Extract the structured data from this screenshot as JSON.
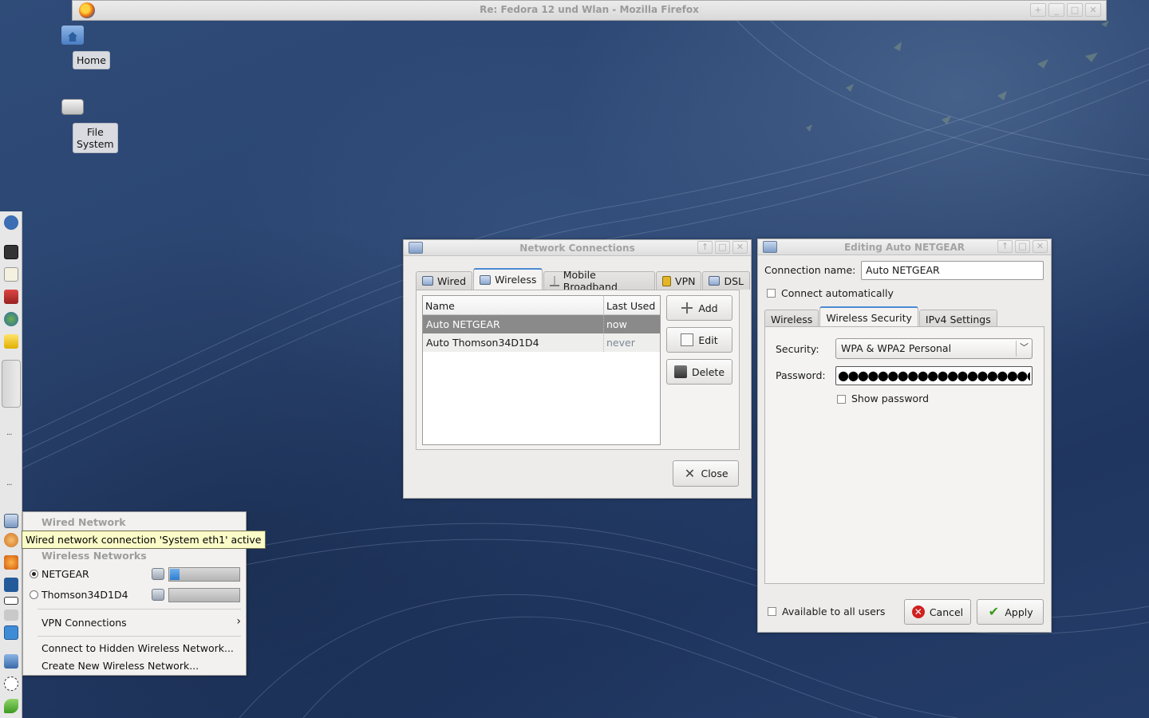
{
  "firefox": {
    "title": "Re: Fedora 12 und Wlan - Mozilla Firefox"
  },
  "desktop": {
    "home_label": "Home",
    "filesystem_label": "File System"
  },
  "netconn": {
    "title": "Network Connections",
    "tabs": [
      "Wired",
      "Wireless",
      "Mobile Broadband",
      "VPN",
      "DSL"
    ],
    "columns": {
      "name": "Name",
      "last_used": "Last Used"
    },
    "rows": [
      {
        "name": "Auto NETGEAR",
        "last_used": "now"
      },
      {
        "name": "Auto Thomson34D1D4",
        "last_used": "never"
      }
    ],
    "buttons": {
      "add": "Add",
      "edit": "Edit",
      "delete": "Delete",
      "close": "Close"
    }
  },
  "editor": {
    "title": "Editing Auto NETGEAR",
    "connection_name_label": "Connection name:",
    "connection_name_value": "Auto NETGEAR",
    "connect_auto_label": "Connect automatically",
    "tabs": [
      "Wireless",
      "Wireless Security",
      "IPv4 Settings"
    ],
    "security_label": "Security:",
    "security_value": "WPA & WPA2 Personal",
    "password_label": "Password:",
    "password_mask": "●●●●●●●●●●●●●●●●●●●●●●●●●●●●●●",
    "show_password_label": "Show password",
    "available_all_label": "Available to all users",
    "cancel_label": "Cancel",
    "apply_label": "Apply"
  },
  "nm_menu": {
    "wired_header": "Wired Network",
    "wireless_header": "Wireless Networks",
    "networks": [
      {
        "ssid": "NETGEAR",
        "selected": true,
        "signal": 0.14
      },
      {
        "ssid": "Thomson34D1D4",
        "selected": false,
        "signal": 0.0
      }
    ],
    "vpn_label": "VPN Connections",
    "hidden_label": "Connect to Hidden Wireless Network...",
    "create_label": "Create New Wireless Network...",
    "tooltip": "Wired network connection 'System eth1' active"
  },
  "colors": {
    "selection": "#8a8a8a",
    "active_tab": "#4c8bd2",
    "tooltip_bg": "#fbfbc8"
  }
}
